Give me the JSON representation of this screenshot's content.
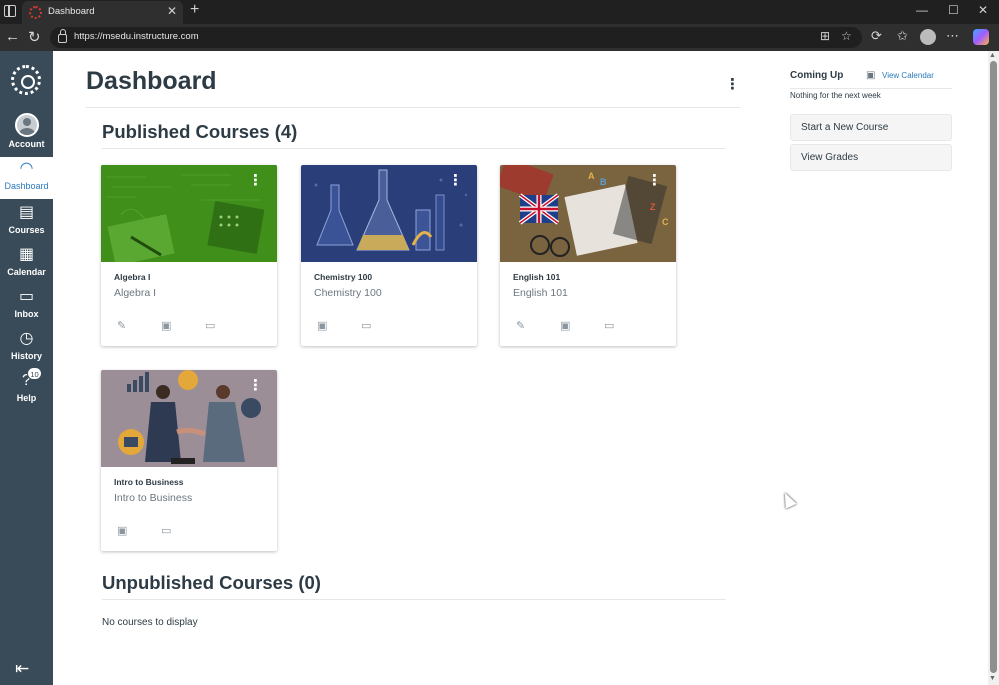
{
  "browser": {
    "tab_title": "Dashboard",
    "tab_close": "✕",
    "new_tab": "+",
    "url": "https://msedu.instructure.com",
    "win_min": "—",
    "win_max": "☐",
    "win_close": "✕"
  },
  "sidebar": {
    "account": "Account",
    "dashboard": "Dashboard",
    "courses": "Courses",
    "calendar": "Calendar",
    "inbox": "Inbox",
    "history": "History",
    "help": "Help",
    "help_badge": "10"
  },
  "main": {
    "title": "Dashboard",
    "published_heading": "Published Courses (4)",
    "unpublished_heading": "Unpublished Courses (0)",
    "no_courses": "No courses to display"
  },
  "courses": [
    {
      "name": "Algebra I",
      "code": "Algebra I",
      "color": "#3f8f1a"
    },
    {
      "name": "Chemistry 100",
      "code": "Chemistry 100",
      "color": "#2a3f7a"
    },
    {
      "name": "English 101",
      "code": "English 101",
      "color": "#8a6a3f"
    },
    {
      "name": "Intro to Business",
      "code": "Intro to Business",
      "color": "#9c8e97"
    }
  ],
  "right": {
    "coming_up": "Coming Up",
    "view_calendar": "View Calendar",
    "nothing": "Nothing for the next week",
    "start_course": "Start a New Course",
    "view_grades": "View Grades"
  }
}
